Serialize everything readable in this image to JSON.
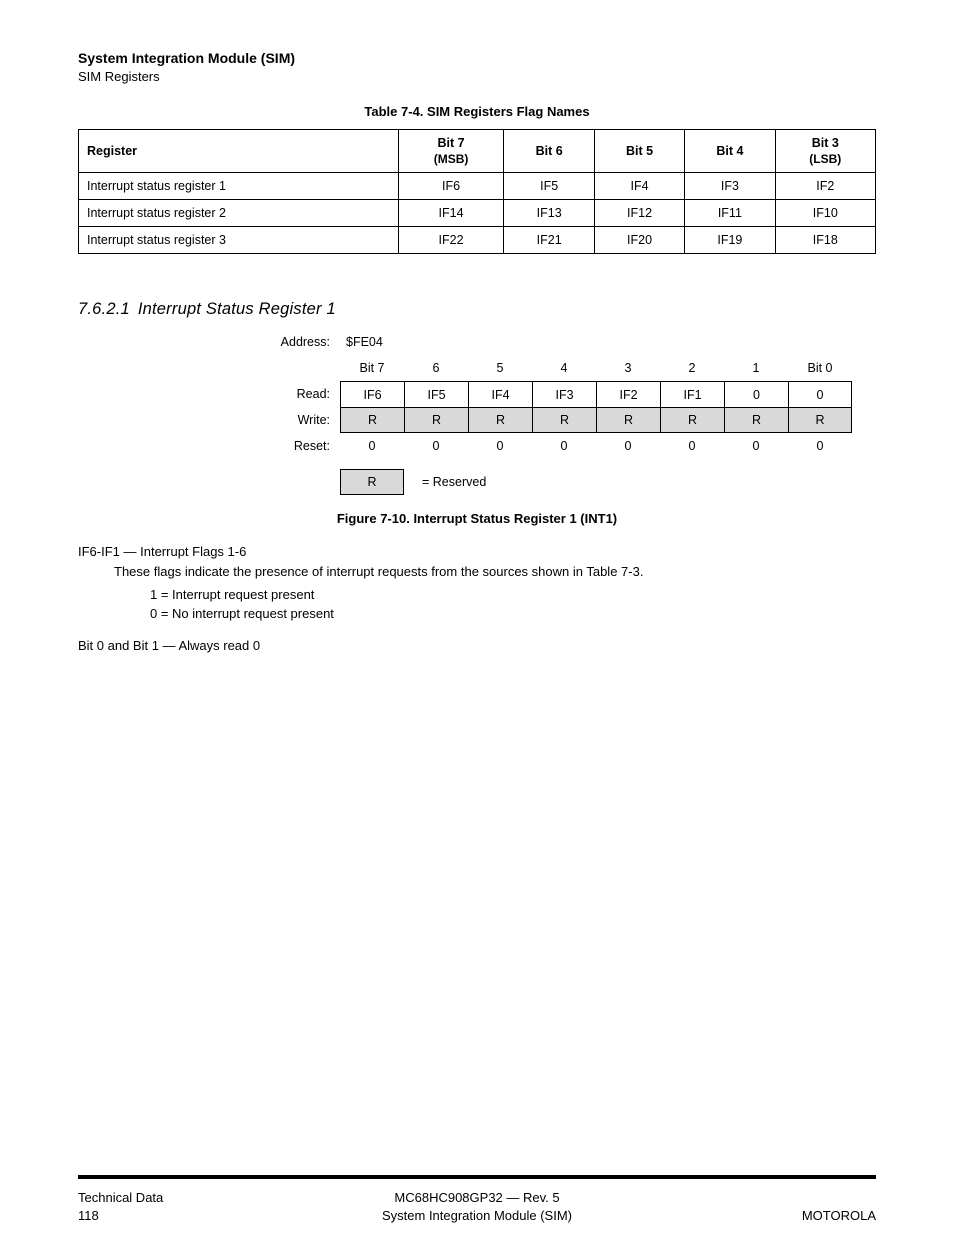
{
  "header": {
    "title": "System Integration Module (SIM)",
    "subtitle": "SIM Registers"
  },
  "table": {
    "caption": "Table 7-4. SIM Registers Flag Names",
    "headers": [
      "Register",
      "Bit 7",
      "Bit 6",
      "Bit 5",
      "Bit 4",
      "Bit 3"
    ],
    "subheaders": [
      "",
      "(MSB)",
      "",
      "",
      "",
      "(LSB)"
    ],
    "rows": [
      [
        "Interrupt status register 1",
        "IF6",
        "IF5",
        "IF4",
        "IF3",
        "IF2"
      ],
      [
        "Interrupt status register 2",
        "IF14",
        "IF13",
        "IF12",
        "IF11",
        "IF10"
      ],
      [
        "Interrupt status register 3",
        "IF22",
        "IF21",
        "IF20",
        "IF19",
        "IF18"
      ]
    ]
  },
  "section": {
    "number": "7.6.2.1",
    "title": "Interrupt Status Register 1"
  },
  "register": {
    "addressLabel": "Address:",
    "address": "$FE04",
    "bitHeaders": [
      "Bit 7",
      "6",
      "5",
      "4",
      "3",
      "2",
      "1",
      "Bit 0"
    ],
    "rows": {
      "readLabel": "Read:",
      "read": [
        "IF6",
        "IF5",
        "IF4",
        "IF3",
        "IF2",
        "IF1",
        "0",
        "0"
      ],
      "writeLabel": "Write:",
      "write": [
        "R",
        "R",
        "R",
        "R",
        "R",
        "R",
        "R",
        "R"
      ],
      "resetLabel": "Reset:",
      "reset": [
        "0",
        "0",
        "0",
        "0",
        "0",
        "0",
        "0",
        "0"
      ]
    },
    "legendBox": "R",
    "legendText": "= Reserved"
  },
  "figureCaption": "Figure 7-10. Interrupt Status Register 1 (INT1)",
  "flags": [
    {
      "heading": "IF6-IF1 — Interrupt Flags 1-6",
      "body": "These flags indicate the presence of interrupt requests from the sources shown in Table 7-3.",
      "rows": [
        "1 = Interrupt request present",
        "0 = No interrupt request present"
      ]
    },
    {
      "heading": "Bit 0 and Bit 1 — Always read 0",
      "body": "",
      "rows": []
    }
  ],
  "footer": {
    "left": "Technical Data",
    "centerLine1": "MC68HC908GP32 — Rev. 5",
    "pageNumber": "118",
    "centerLine2": "System Integration Module (SIM)",
    "right": "MOTOROLA"
  }
}
